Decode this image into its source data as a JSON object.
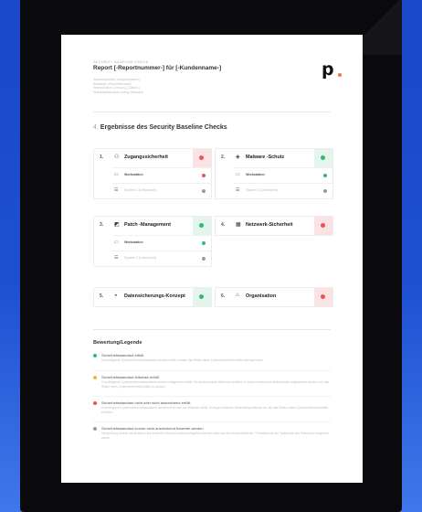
{
  "header": {
    "small_label": "SECURITY BASELINE CHECK",
    "title": "Report [-Reportnummer-] für [-Kundenname-]",
    "meta_lines": [
      "Ansprechpartner [-Ansprechpartner-]",
      "Bearbeiter [-Bearbeitername-]",
      "Version/Datum [-Version-] [-Datum-]",
      "Vertraulichkeitsstufe: streng vertraulich"
    ],
    "logo_text": "p"
  },
  "section": {
    "number": "4.",
    "title": "Ergebnisse des Security Baseline Checks"
  },
  "cards": [
    {
      "num": "1.",
      "icon": "user-group-icon",
      "glyph": "⚇",
      "title": "Zugangssicherheit",
      "status": "red",
      "subs": [
        {
          "icon": "laptop-icon",
          "glyph": "▭",
          "label": "Workstation",
          "status": "red",
          "muted": false
        },
        {
          "icon": "server-icon",
          "glyph": "☰",
          "label": "System 2 (Urbekannt)",
          "status": "grey",
          "muted": true
        }
      ]
    },
    {
      "num": "2.",
      "icon": "shield-icon",
      "glyph": "◈",
      "title": "Malware -Schutz",
      "status": "green",
      "subs": [
        {
          "icon": "laptop-icon",
          "glyph": "▭",
          "label": "Workstation",
          "status": "green",
          "muted": false
        },
        {
          "icon": "server-icon",
          "glyph": "☰",
          "label": "System 2 (Urbekannt)",
          "status": "grey",
          "muted": true
        }
      ]
    },
    {
      "num": "3.",
      "icon": "patch-icon",
      "glyph": "◩",
      "title": "Patch -Management",
      "status": "green",
      "subs": [
        {
          "icon": "laptop-icon",
          "glyph": "▭",
          "label": "Workstation",
          "status": "green",
          "muted": false
        },
        {
          "icon": "server-icon",
          "glyph": "☰",
          "label": "System 2 (Urbekannt)",
          "status": "grey",
          "muted": true
        }
      ]
    },
    {
      "num": "4.",
      "icon": "network-icon",
      "glyph": "▦",
      "title": "Netzwerk-Sicherheit",
      "status": "red",
      "subs": []
    },
    {
      "num": "5.",
      "icon": "backup-icon",
      "glyph": "◒",
      "title": "Datensicherungs-Konzept",
      "status": "green",
      "subs": []
    },
    {
      "num": "6.",
      "icon": "organisation-icon",
      "glyph": "⌂",
      "title": "Organisation",
      "status": "red",
      "subs": []
    }
  ],
  "legend": {
    "title": "Bewertung/Legende",
    "items": [
      {
        "status": "green",
        "heading": "Sicherheitsstandard erfüllt",
        "desc": "Grundlegende Cybersicherheitsstandards werden erfüllt, sodass das Risiko eines Cybersicherheitsvorfalls verringert wird."
      },
      {
        "status": "yellow",
        "heading": "Sicherheitsstandard teilweise erfüllt",
        "desc": "Grundlegende Cybersicherheitsstandards werden weitgehend erfüllt. Es wurden jedoch Bereiche ermittelt, in denen verbesserte Maßnahmen angewendet werden, um das Risiko eines Cybersicherheitsvorfalls zu senken."
      },
      {
        "status": "red",
        "heading": "Sicherheitsstandard nicht oder nicht ausreichend erfüllt",
        "desc": "Grundlegende Cybersicherheitsstandards werden nicht oder nur teilweise erfüllt. Es liegen kritische Sicherheitsprobleme vor, die das Risiko eines Cybersicherheitsvorfalls erhöhen."
      },
      {
        "status": "grey",
        "heading": "Sicherheitsstandard konnte nicht ausreichend bewertet werden",
        "desc": "Überprüfung konnte mit Analysen aus externen Gründen nicht durchgeführt werden oder aus dem Komplexität der IT-Infrastruktur als \"außerhalb des Rahmens\" eingestuft wurde."
      }
    ]
  },
  "colors": {
    "green": "#35b877",
    "red": "#e35757",
    "yellow": "#f1b43e",
    "grey": "#9b9b9b",
    "accent": "#f07a3c"
  }
}
